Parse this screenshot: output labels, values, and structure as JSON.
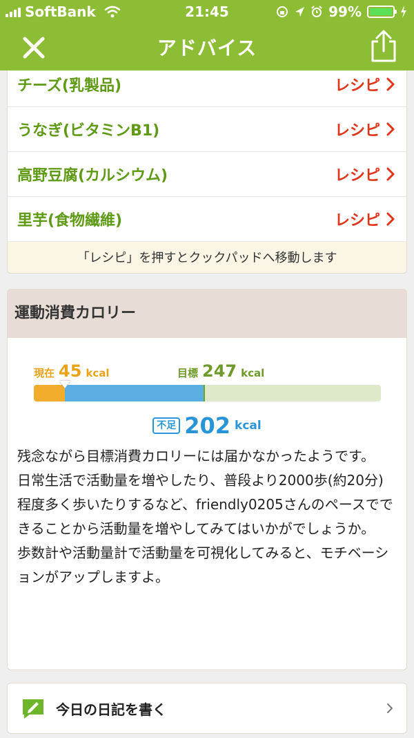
{
  "status_bar": {
    "carrier": "SoftBank",
    "time": "21:45",
    "battery": "99%"
  },
  "header": {
    "title": "アドバイス",
    "close_icon": "close-icon",
    "share_icon": "share-icon"
  },
  "recipes": {
    "items": [
      {
        "name": "チーズ(乳製品)",
        "link": "レシピ"
      },
      {
        "name": "うなぎ(ビタミンB1)",
        "link": "レシピ"
      },
      {
        "name": "高野豆腐(カルシウム)",
        "link": "レシピ"
      },
      {
        "name": "里芋(食物繊維)",
        "link": "レシピ"
      }
    ],
    "note": "「レシピ」を押すとクックパッドへ移動します"
  },
  "exercise": {
    "title": "運動消費カロリー",
    "current_label": "現在",
    "current_value": "45",
    "goal_label": "目標",
    "goal_value": "247",
    "unit": "kcal",
    "shortage_label": "不足",
    "shortage_value": "202",
    "bar_max": 500,
    "current": 45,
    "goal": 247,
    "advice": [
      "残念ながら目標消費カロリーには届かなかったようです。",
      "日常生活で活動量を増やしたり、普段より2000歩(約20分)程度多く歩いたりするなど、friendly0205さんのペースでできることから活動量を増やしてみてはいかがでしょうか。",
      "歩数計や活動量計で活動量を可視化してみると、モチベーションがアップしますよ。"
    ]
  },
  "diary": {
    "label": "今日の日記を書く",
    "icon": "pencil-note-icon"
  },
  "colors": {
    "header": "#8cbd34",
    "recipe_name": "#5e9a14",
    "recipe_link": "#e0341a",
    "current": "#f3ad2c",
    "shortage": "#5aaee2",
    "goal_track": "#dde9c9"
  }
}
